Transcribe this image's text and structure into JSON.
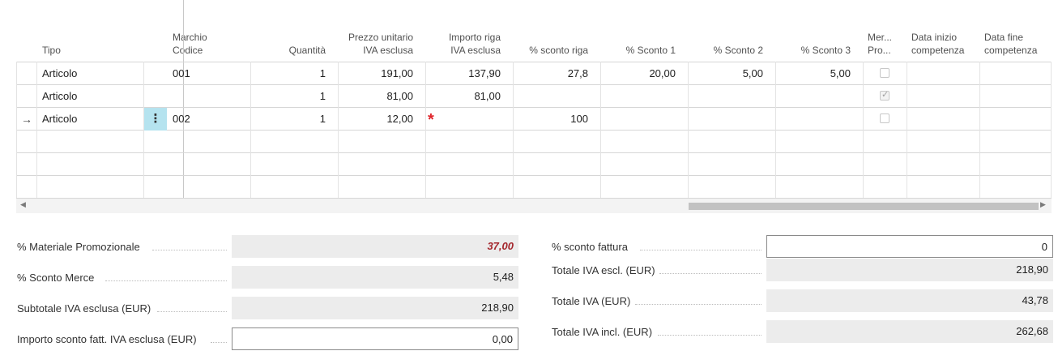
{
  "grid": {
    "headers": {
      "tipo": "Tipo",
      "marchio_codice": [
        "Marchio",
        "Codice"
      ],
      "quantita": "Quantità",
      "prezzo": [
        "Prezzo unitario",
        "IVA esclusa"
      ],
      "importo": [
        "Importo riga",
        "IVA esclusa"
      ],
      "sconto_riga": "% sconto riga",
      "sconto1": "% Sconto 1",
      "sconto2": "% Sconto 2",
      "sconto3": "% Sconto 3",
      "merce_promo": [
        "Mer...",
        "Pro..."
      ],
      "data_inizio": [
        "Data inizio",
        "competenza"
      ],
      "data_fine": [
        "Data fine",
        "competenza"
      ]
    },
    "rows": [
      {
        "tipo": "Articolo",
        "codice": "001",
        "quantita": "1",
        "prezzo": "191,00",
        "importo": "137,90",
        "sconto_riga": "27,8",
        "sconto1": "20,00",
        "sconto2": "5,00",
        "sconto3": "5,00",
        "promo": false
      },
      {
        "tipo": "Articolo",
        "codice": "",
        "quantita": "1",
        "prezzo": "81,00",
        "importo": "81,00",
        "sconto_riga": "",
        "sconto1": "",
        "sconto2": "",
        "sconto3": "",
        "promo": true
      },
      {
        "tipo": "Articolo",
        "codice": "002",
        "quantita": "1",
        "prezzo": "12,00",
        "importo": "",
        "sconto_riga": "100",
        "sconto1": "",
        "sconto2": "",
        "sconto3": "",
        "promo": false
      }
    ],
    "current_row_marker": "→",
    "row_menu_glyph": "⋮",
    "required_marker": "*"
  },
  "totals_left": [
    {
      "label": "% Materiale Promozionale",
      "value": "37,00"
    },
    {
      "label": "% Sconto Merce",
      "value": "5,48"
    },
    {
      "label": "Subtotale IVA esclusa (EUR)",
      "value": "218,90"
    },
    {
      "label": "Importo sconto fatt. IVA esclusa (EUR)",
      "value": "0,00"
    }
  ],
  "totals_right": [
    {
      "label": "% sconto fattura",
      "value": "0"
    },
    {
      "label": "Totale IVA escl. (EUR)",
      "value": "218,90"
    },
    {
      "label": "Totale IVA (EUR)",
      "value": "43,78"
    },
    {
      "label": "Totale IVA incl. (EUR)",
      "value": "262,68"
    }
  ],
  "colors": {
    "accent_row_menu": "#b5e3ef",
    "required": "#e0262c",
    "emphasis": "#a4262c"
  }
}
